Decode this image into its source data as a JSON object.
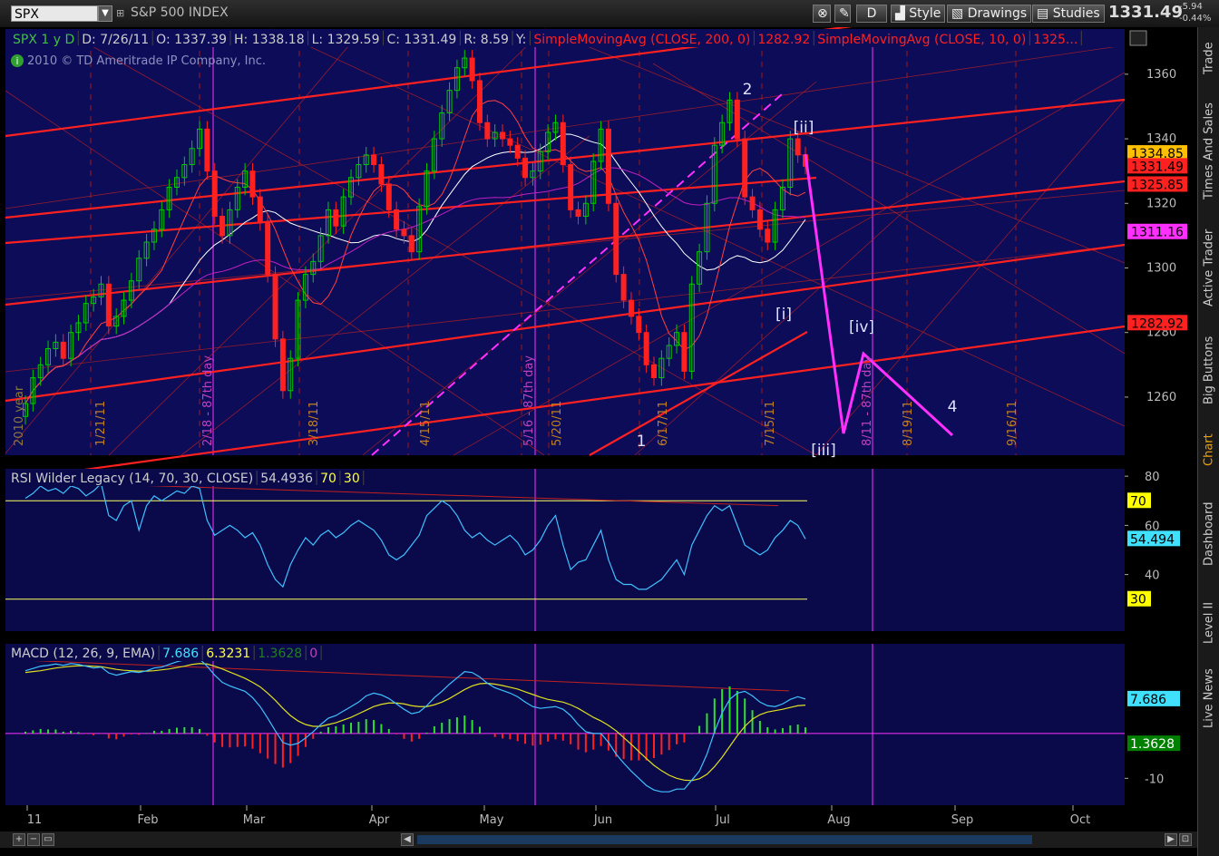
{
  "toolbar": {
    "symbol": "SPX",
    "index_name": "S&P 500 INDEX",
    "d_button": "D",
    "style_label": "Style",
    "drawings_label": "Drawings",
    "studies_label": "Studies",
    "last_price": "1331.49",
    "change": "-5.94",
    "change_pct": "-0.44%"
  },
  "sidebar": {
    "tabs": [
      "Trade",
      "Times And Sales",
      "Active Trader",
      "Big Buttons",
      "Chart",
      "Dashboard",
      "Level II",
      "Live News"
    ],
    "active": "Chart"
  },
  "colors": {
    "background": "#000000",
    "panel_bg": "#0a0a4a",
    "price_panel_bg": "#0c0c58",
    "candle_up": "#00cc00",
    "candle_down": "#ff2020",
    "channel": "#ff2020",
    "magenta": "#ff30ff",
    "rsi_line": "#40c0ff",
    "macd_signal": "#e0e020",
    "white_ma": "#ffffff"
  },
  "chart_data": [
    {
      "type": "line",
      "name": "price",
      "header": {
        "symbol": "SPX 1 y D",
        "date": "D: 7/26/11",
        "open": "O: 1337.39",
        "high": "H: 1338.18",
        "low": "L: 1329.59",
        "close": "C: 1331.49",
        "range": "R: 8.59",
        "y": "Y:",
        "sma200": "SimpleMovingAvg (CLOSE, 200, 0)",
        "sma200_val": "1282.92",
        "sma10": "SimpleMovingAvg (CLOSE, 10, 0)",
        "sma10_val": "1325..."
      },
      "copyright": "2010 © TD Ameritrade IP Company, Inc.",
      "ylim": [
        1242,
        1374
      ],
      "yticks": [
        1260,
        1280,
        1300,
        1320,
        1340,
        1360
      ],
      "price_labels": [
        {
          "text": "1334.85",
          "value": 1335.5,
          "bg": "#ffc000",
          "fg": "#000000"
        },
        {
          "text": "1331.49",
          "value": 1331.49,
          "bg": "#ff2020",
          "fg": "#000000"
        },
        {
          "text": "1325.85",
          "value": 1325.85,
          "bg": "#ff2020",
          "fg": "#000000"
        },
        {
          "text": "1311.16",
          "value": 1311.16,
          "bg": "#ff30ff",
          "fg": "#000000"
        },
        {
          "text": "1282.92",
          "value": 1282.92,
          "bg": "#ff2020",
          "fg": "#000000"
        }
      ],
      "date_labels": [
        "2010 year",
        "1/21/11",
        "2/18 - 87th day",
        "3/18/11",
        "4/15/11",
        "5/16 - 87th day",
        "5/20/11",
        "6/17/11",
        "7/15/11",
        "8/11 - 87th day",
        "8/19/11",
        "9/16/11"
      ],
      "wave_labels": [
        "2",
        "[ii]",
        "[i]",
        "[iv]",
        "1",
        "4",
        "[iii]"
      ],
      "close": [
        1258,
        1266,
        1270,
        1275,
        1277,
        1272,
        1280,
        1283,
        1289,
        1291,
        1295,
        1282,
        1285,
        1290,
        1296,
        1303,
        1308,
        1312,
        1318,
        1325,
        1328,
        1332,
        1337,
        1343,
        1330,
        1316,
        1310,
        1318,
        1325,
        1330,
        1322,
        1314,
        1298,
        1278,
        1262,
        1272,
        1290,
        1298,
        1302,
        1310,
        1318,
        1313,
        1322,
        1328,
        1332,
        1335,
        1332,
        1326,
        1318,
        1312,
        1310,
        1305,
        1319,
        1330,
        1340,
        1348,
        1355,
        1362,
        1365,
        1358,
        1345,
        1340,
        1342,
        1340,
        1338,
        1334,
        1328,
        1330,
        1336,
        1342,
        1345,
        1332,
        1318,
        1316,
        1320,
        1333,
        1343,
        1320,
        1298,
        1290,
        1285,
        1280,
        1270,
        1266,
        1272,
        1276,
        1280,
        1268,
        1295,
        1305,
        1320,
        1338,
        1345,
        1352,
        1340,
        1322,
        1318,
        1312,
        1308,
        1318,
        1325,
        1340,
        1335,
        1331.49
      ]
    },
    {
      "type": "line",
      "name": "rsi",
      "header": {
        "label": "RSI Wilder Legacy (14, 70, 30, CLOSE)",
        "value": "54.4936",
        "ob": "70",
        "os": "30"
      },
      "ylim": [
        17,
        83
      ],
      "yticks": [
        40,
        60,
        80
      ],
      "price_labels": [
        {
          "text": "70",
          "value": 70,
          "bg": "#ffff00",
          "fg": "#000000"
        },
        {
          "text": "54.494",
          "value": 54.494,
          "bg": "#40e0ff",
          "fg": "#000000"
        },
        {
          "text": "30",
          "value": 30,
          "bg": "#ffff00",
          "fg": "#000000"
        }
      ],
      "values": [
        71,
        73,
        76,
        74,
        75,
        73,
        76,
        75,
        72,
        74,
        77,
        64,
        62,
        68,
        70,
        58,
        68,
        72,
        70,
        72,
        74,
        73,
        76,
        75,
        62,
        56,
        58,
        60,
        58,
        55,
        57,
        52,
        44,
        38,
        35,
        44,
        50,
        55,
        52,
        56,
        58,
        55,
        57,
        60,
        62,
        60,
        58,
        54,
        48,
        46,
        48,
        52,
        56,
        64,
        67,
        70,
        68,
        64,
        58,
        55,
        57,
        54,
        52,
        54,
        56,
        53,
        48,
        50,
        54,
        60,
        64,
        52,
        42,
        45,
        46,
        52,
        58,
        46,
        38,
        36,
        36,
        34,
        34,
        36,
        38,
        42,
        46,
        40,
        52,
        58,
        64,
        68,
        66,
        68,
        60,
        52,
        50,
        48,
        50,
        55,
        58,
        62,
        60,
        54.49
      ]
    },
    {
      "type": "bar",
      "name": "macd",
      "header": {
        "label": "MACD (12, 26, 9, EMA)",
        "value": "7.686",
        "avg": "6.3231",
        "diff": "1.3628",
        "zero": "0"
      },
      "ylim": [
        -16,
        20
      ],
      "yticks": [
        -10
      ],
      "price_labels": [
        {
          "text": "7.686",
          "value": 7.686,
          "bg": "#40e0ff",
          "fg": "#000000"
        },
        {
          "text": "1.3628",
          "value": 1.3628,
          "bg": "#008000",
          "fg": "#ffffff"
        }
      ],
      "macd": [
        14,
        14.5,
        15,
        15.2,
        15.5,
        15.2,
        15.6,
        15.4,
        15,
        14.6,
        14.8,
        13.5,
        13,
        13.4,
        13.8,
        13.6,
        14,
        14.6,
        14.8,
        15.4,
        16,
        16.4,
        16.8,
        16.6,
        15,
        13,
        11.4,
        10.6,
        10,
        9.4,
        8,
        6,
        3.4,
        0.6,
        -2,
        -2.6,
        -2.2,
        -1,
        0.4,
        2,
        3.4,
        4,
        5,
        6,
        7,
        8.4,
        9,
        8.6,
        7.8,
        6.6,
        5.4,
        4.4,
        4.8,
        6.2,
        8,
        9.4,
        11,
        12.4,
        13.8,
        13.6,
        12.6,
        11.2,
        10.2,
        9.6,
        9,
        8.2,
        7,
        6,
        5.6,
        5.8,
        6,
        5.4,
        4,
        2,
        0.4,
        0,
        0,
        -2,
        -4.6,
        -6.6,
        -8.4,
        -10,
        -11.6,
        -12.6,
        -13,
        -13,
        -12.4,
        -12.4,
        -10.4,
        -8.4,
        -4.6,
        0.4,
        4.6,
        7.6,
        9,
        9.4,
        8.4,
        7,
        6.2,
        6,
        6.6,
        7.6,
        8.2,
        7.69
      ],
      "signal": [
        13.6,
        13.8,
        14,
        14.3,
        14.6,
        14.8,
        15,
        15.1,
        15.1,
        15,
        14.9,
        14.6,
        14.3,
        14.1,
        14,
        13.9,
        13.9,
        14,
        14.2,
        14.4,
        14.7,
        15,
        15.4,
        15.6,
        15.5,
        15,
        14.4,
        13.7,
        13,
        12.3,
        11.4,
        10.4,
        9,
        7.4,
        5.6,
        4,
        2.8,
        2,
        1.6,
        1.6,
        2,
        2.4,
        3,
        3.6,
        4.4,
        5.2,
        6,
        6.5,
        6.8,
        6.8,
        6.6,
        6.2,
        6,
        6,
        6.4,
        7,
        7.8,
        8.8,
        9.8,
        10.6,
        11.1,
        11.2,
        11,
        10.7,
        10.3,
        9.9,
        9.3,
        8.7,
        8.1,
        7.6,
        7.3,
        7,
        6.4,
        5.6,
        4.6,
        3.6,
        2.8,
        1.8,
        0.6,
        -0.9,
        -2.4,
        -4,
        -5.6,
        -7.1,
        -8.3,
        -9.3,
        -10,
        -10.4,
        -10.5,
        -10.1,
        -9.1,
        -7.4,
        -5.3,
        -2.9,
        -0.5,
        1.6,
        3.2,
        4.2,
        4.8,
        5.1,
        5.4,
        5.8,
        6.2,
        6.32
      ]
    }
  ],
  "time_axis": {
    "labels": [
      "11",
      "Feb",
      "Mar",
      "Apr",
      "May",
      "Jun",
      "Jul",
      "Aug",
      "Sep",
      "Oct"
    ]
  },
  "bottom": {
    "plus": "+",
    "minus": "−",
    "left_arrow": "◀",
    "right_arrow": "▶"
  }
}
